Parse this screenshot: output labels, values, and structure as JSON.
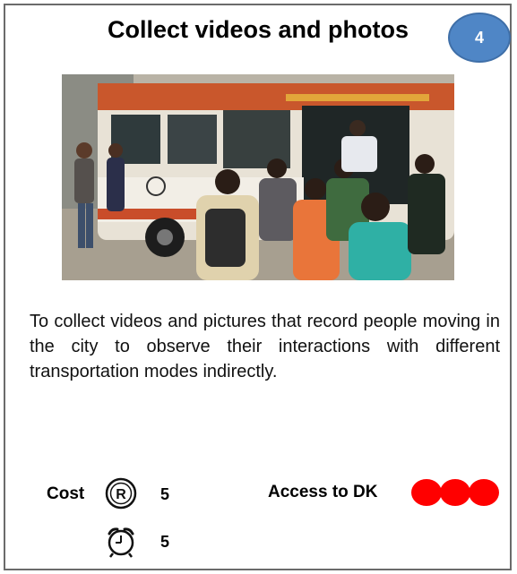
{
  "card": {
    "title": "Collect videos and photos",
    "number": "4",
    "description": "To collect videos and pictures that record people moving in the city to observe their interactions with different transportation modes indirectly.",
    "cost_label": "Cost",
    "cost_icon_letter": "R",
    "cost_value": "5",
    "time_value": "5",
    "access_label": "Access to DK",
    "access_level": 3,
    "colors": {
      "badge": "#4f86c6",
      "access_dots": "#ff0000"
    }
  }
}
